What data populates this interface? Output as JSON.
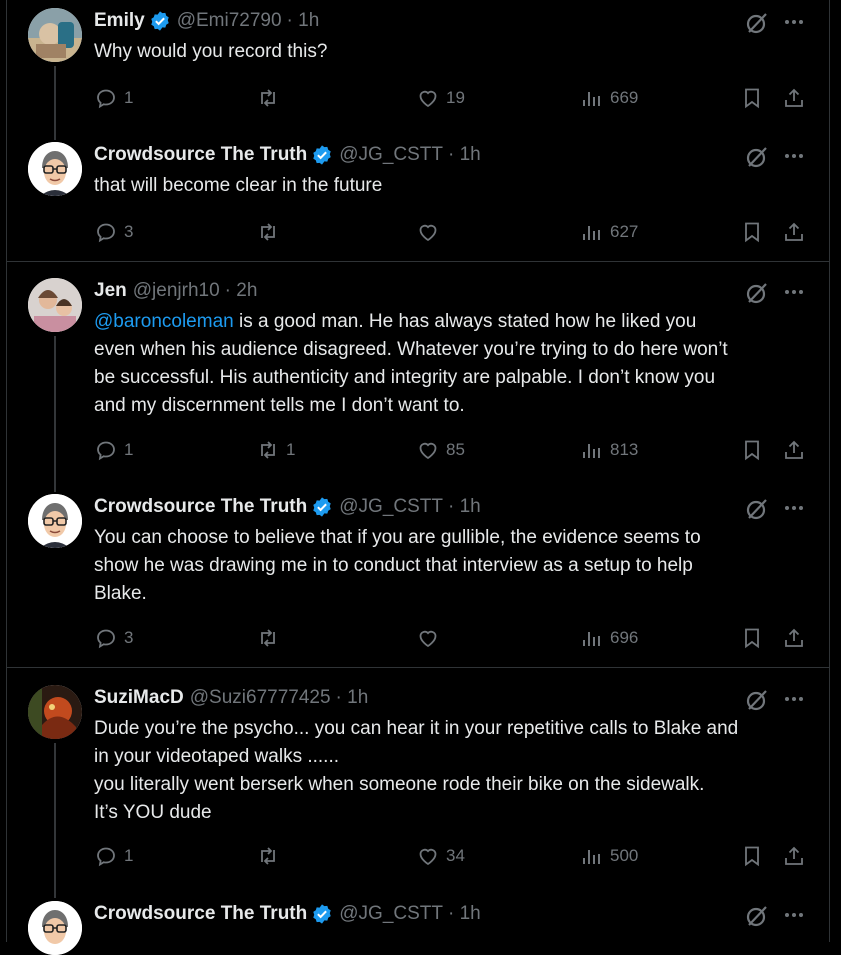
{
  "tweets": [
    {
      "name": "Emily",
      "handle": "@Emi72790",
      "time": "· 1h",
      "lines": [
        "Why would you record this?"
      ],
      "replies": "1",
      "reposts": "",
      "likes": "19",
      "views": "669"
    },
    {
      "name": "Crowdsource The Truth",
      "handle": "@JG_CSTT",
      "time": "· 1h",
      "lines": [
        "that will become clear in the future"
      ],
      "replies": "3",
      "reposts": "",
      "likes": "",
      "views": "627"
    },
    {
      "name": "Jen",
      "handle": "@jenjrh10",
      "time": "· 2h",
      "mention": "@baroncoleman",
      "lines": [
        " is a good man. He has always stated how he liked you",
        "even when his audience disagreed. Whatever you’re trying to do here won’t",
        "be successful. His authenticity and integrity are palpable. I don’t know you",
        "and my discernment tells me I don’t want to."
      ],
      "replies": "1",
      "reposts": "1",
      "likes": "85",
      "views": "813"
    },
    {
      "name": "Crowdsource The Truth",
      "handle": "@JG_CSTT",
      "time": "· 1h",
      "lines": [
        "You can choose to believe that if you are gullible, the evidence seems to",
        "show he was drawing me in to conduct that interview as a setup to help",
        "Blake."
      ],
      "replies": "3",
      "reposts": "",
      "likes": "",
      "views": "696"
    },
    {
      "name": "SuziMacD",
      "handle": "@Suzi67777425",
      "time": "· 1h",
      "lines": [
        "Dude you’re the psycho... you can hear it in your repetitive calls to Blake and",
        "in your videotaped walks ......",
        "you literally went berserk when someone rode their bike on the sidewalk.",
        "It’s YOU dude"
      ],
      "replies": "1",
      "reposts": "",
      "likes": "34",
      "views": "500"
    },
    {
      "name": "Crowdsource The Truth",
      "handle": "@JG_CSTT",
      "time": "· 1h",
      "lines": [],
      "replies": "",
      "reposts": "",
      "likes": "",
      "views": ""
    }
  ],
  "colors": {
    "accent": "#1d9bf0",
    "muted": "#71767b",
    "text": "#e7e9ea",
    "background": "#000000",
    "border": "#2f3336"
  },
  "icons": [
    "verified-badge-icon",
    "grok-icon",
    "more-icon",
    "reply-icon",
    "repost-icon",
    "like-icon",
    "views-icon",
    "bookmark-icon",
    "share-icon"
  ]
}
